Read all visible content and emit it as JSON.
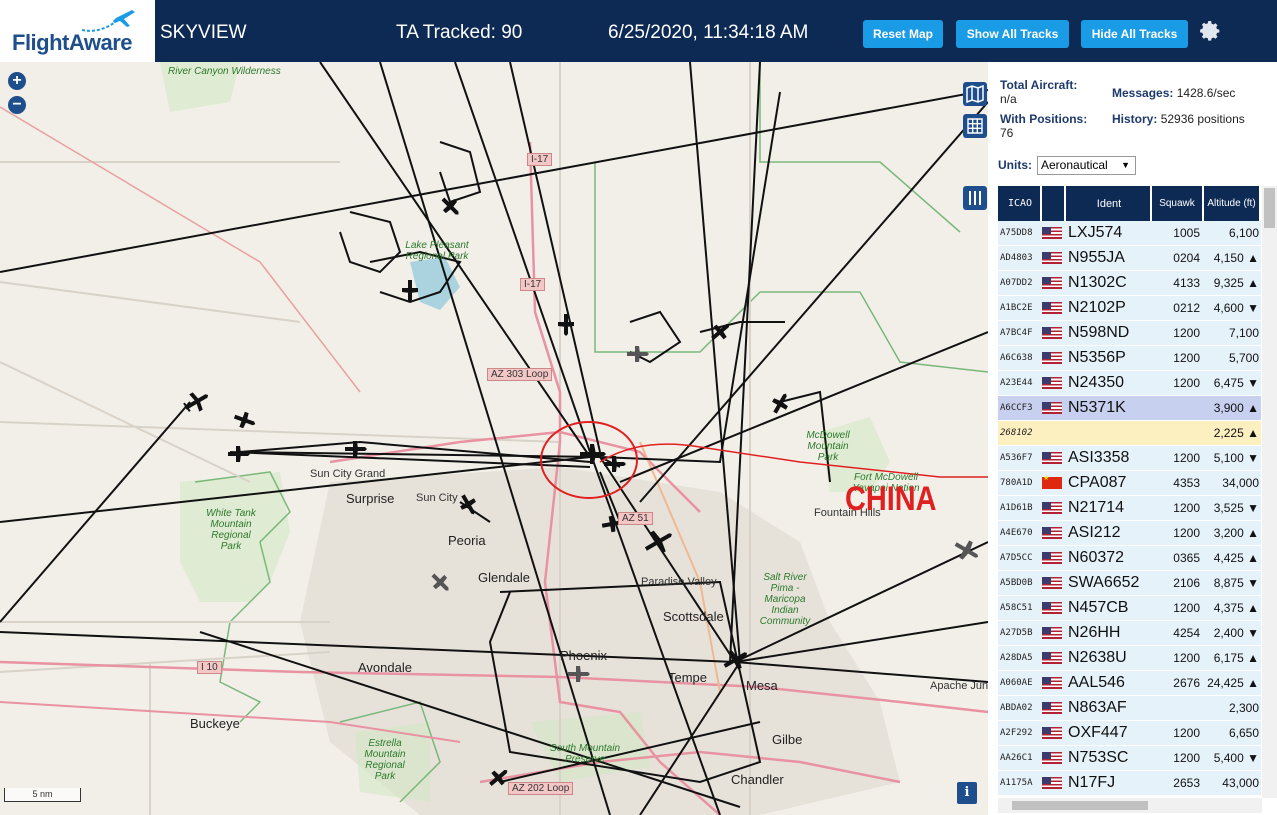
{
  "header": {
    "logo_text": "FlightAware",
    "app_title": "SKYVIEW",
    "tracked": "TA Tracked: 90",
    "datetime": "6/25/2020, 11:34:18 AM",
    "reset_map": "Reset Map",
    "show_all_tracks": "Show All Tracks",
    "hide_all_tracks": "Hide All Tracks",
    "settings_icon": "gear-icon"
  },
  "map": {
    "annotation": "CHINA",
    "annotation_color": "#e02020",
    "scale": "5 nm",
    "zoom_in": "+",
    "zoom_out": "−",
    "info": "i",
    "labels": {
      "wickenburg_park": "River Canyon Wilderness",
      "lake_pleasant": "Lake Pleasant Regional Park",
      "mcdowell": "McDowell Mountain Park",
      "white_tank": "White Tank Mountain Regional Park",
      "estrella": "Estrella Mountain Regional Park",
      "south_mountain": "South Mountain Preserve",
      "salt_river": "Salt River Pima - Maricopa Indian Community",
      "fort_mcdowell": "Fort McDowell Yavapai Nation",
      "sun_city_grand": "Sun City Grand",
      "surprise": "Surprise",
      "sun_city": "Sun City",
      "peoria": "Peoria",
      "glendale": "Glendale",
      "paradise_valley": "Paradise Valley",
      "scottsdale": "Scottsdale",
      "fountain_hills": "Fountain Hills",
      "phoenix": "Phoenix",
      "tempe": "Tempe",
      "mesa": "Mesa",
      "avondale": "Avondale",
      "buckeye": "Buckeye",
      "gilbert": "Gilbe",
      "chandler": "Chandler",
      "apache_junction": "Apache Junc"
    },
    "highways": {
      "i17_top": "I-17",
      "i17_mid": "I-17",
      "az303": "AZ 303 Loop",
      "az51": "AZ 51",
      "i10": "I 10",
      "az202": "AZ 202 Loop"
    }
  },
  "stats": {
    "total_aircraft_label": "Total Aircraft:",
    "total_aircraft_value": "n/a",
    "with_positions_label": "With Positions:",
    "with_positions_value": "76",
    "messages_label": "Messages:",
    "messages_value": "1428.6/sec",
    "history_label": "History:",
    "history_value": "52936 positions",
    "units_label": "Units:",
    "units_value": "Aeronautical"
  },
  "table": {
    "headers": [
      "ICAO",
      "",
      "Ident",
      "Squawk",
      "Altitude (ft)"
    ],
    "rows": [
      {
        "icao": "A75DD8",
        "flag": "us",
        "ident": "LXJ574",
        "squawk": "1005",
        "alt": "6,100"
      },
      {
        "icao": "AD4803",
        "flag": "us",
        "ident": "N955JA",
        "squawk": "0204",
        "alt": "4,150 ▲"
      },
      {
        "icao": "A07DD2",
        "flag": "us",
        "ident": "N1302C",
        "squawk": "4133",
        "alt": "9,325 ▲"
      },
      {
        "icao": "A1BC2E",
        "flag": "us",
        "ident": "N2102P",
        "squawk": "0212",
        "alt": "4,600 ▼"
      },
      {
        "icao": "A7BC4F",
        "flag": "us",
        "ident": "N598ND",
        "squawk": "1200",
        "alt": "7,100"
      },
      {
        "icao": "A6C638",
        "flag": "us",
        "ident": "N5356P",
        "squawk": "1200",
        "alt": "5,700"
      },
      {
        "icao": "A23E44",
        "flag": "us",
        "ident": "N24350",
        "squawk": "1200",
        "alt": "6,475 ▼"
      },
      {
        "icao": "A6CCF3",
        "flag": "us",
        "ident": "N5371K",
        "squawk": "",
        "alt": "3,900 ▲",
        "state": "sel"
      },
      {
        "icao": "268102",
        "flag": "",
        "ident": "",
        "squawk": "",
        "alt": "2,225 ▲",
        "state": "nopos"
      },
      {
        "icao": "A536F7",
        "flag": "us",
        "ident": "ASI3358",
        "squawk": "1200",
        "alt": "5,100 ▼"
      },
      {
        "icao": "780A1D",
        "flag": "cn",
        "ident": "CPA087",
        "squawk": "4353",
        "alt": "34,000"
      },
      {
        "icao": "A1D61B",
        "flag": "us",
        "ident": "N21714",
        "squawk": "1200",
        "alt": "3,525 ▼"
      },
      {
        "icao": "A4E670",
        "flag": "us",
        "ident": "ASI212",
        "squawk": "1200",
        "alt": "3,200 ▲"
      },
      {
        "icao": "A7D5CC",
        "flag": "us",
        "ident": "N60372",
        "squawk": "0365",
        "alt": "4,425 ▲"
      },
      {
        "icao": "A5BD0B",
        "flag": "us",
        "ident": "SWA6652",
        "squawk": "2106",
        "alt": "8,875 ▼"
      },
      {
        "icao": "A58C51",
        "flag": "us",
        "ident": "N457CB",
        "squawk": "1200",
        "alt": "4,375 ▲"
      },
      {
        "icao": "A27D5B",
        "flag": "us",
        "ident": "N26HH",
        "squawk": "4254",
        "alt": "2,400 ▼"
      },
      {
        "icao": "A28DA5",
        "flag": "us",
        "ident": "N2638U",
        "squawk": "1200",
        "alt": "6,175 ▲"
      },
      {
        "icao": "A060AE",
        "flag": "us",
        "ident": "AAL546",
        "squawk": "2676",
        "alt": "24,425 ▲"
      },
      {
        "icao": "ABDA02",
        "flag": "us",
        "ident": "N863AF",
        "squawk": "",
        "alt": "2,300"
      },
      {
        "icao": "A2F292",
        "flag": "us",
        "ident": "OXF447",
        "squawk": "1200",
        "alt": "6,650"
      },
      {
        "icao": "AA26C1",
        "flag": "us",
        "ident": "N753SC",
        "squawk": "1200",
        "alt": "5,400 ▼"
      },
      {
        "icao": "A1175A",
        "flag": "us",
        "ident": "N17FJ",
        "squawk": "2653",
        "alt": "43,000"
      }
    ]
  }
}
